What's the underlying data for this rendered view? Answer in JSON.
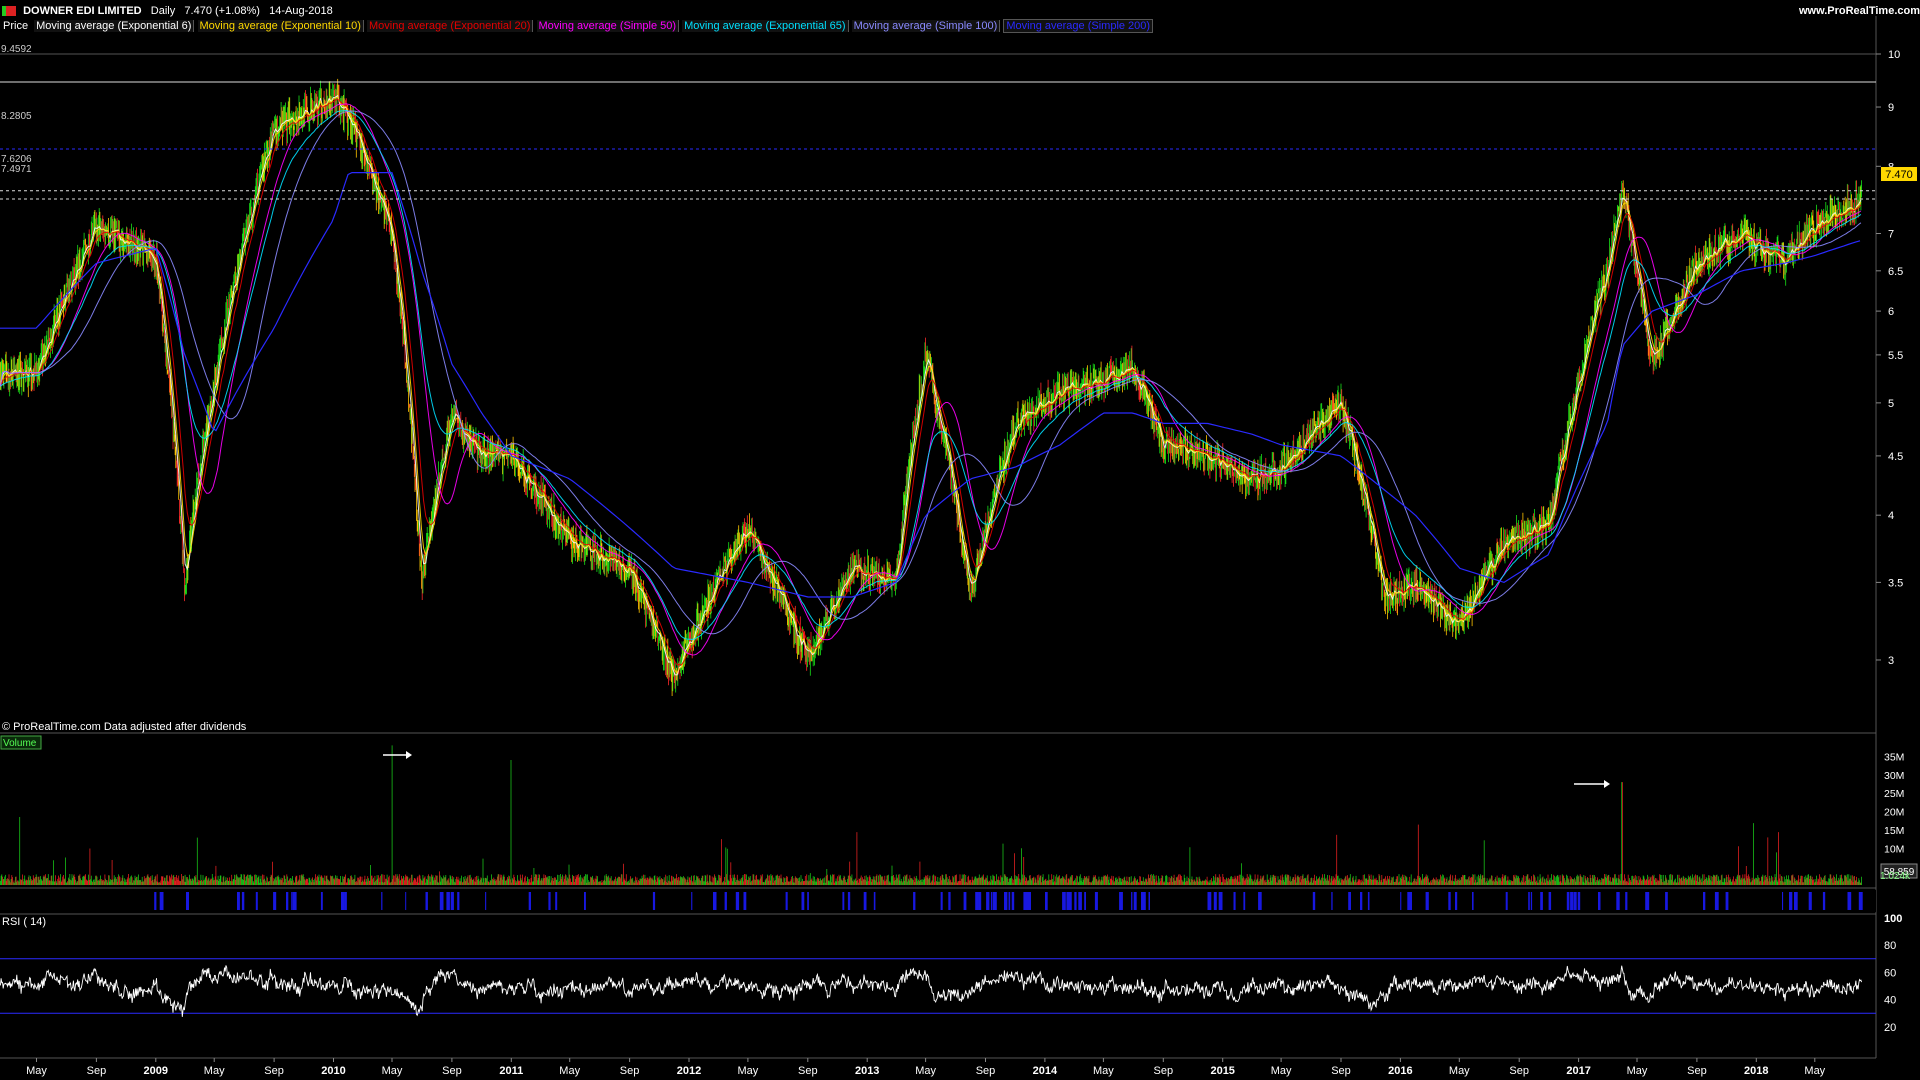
{
  "header": {
    "instrument": "DOWNER EDI LIMITED",
    "interval": "Daily",
    "last": "7.470 (+1.08%)",
    "date": "14-Aug-2018",
    "site": "www.ProRealTime.com"
  },
  "legend": {
    "price": "Price",
    "items": [
      {
        "label": "Moving average (Exponential 6)",
        "color": "#ffffff"
      },
      {
        "label": "Moving average (Exponential 10)",
        "color": "#ffd800"
      },
      {
        "label": "Moving average (Exponential 20)",
        "color": "#e60000"
      },
      {
        "label": "Moving average (Simple 50)",
        "color": "#ff00ff"
      },
      {
        "label": "Moving average (Exponential 65)",
        "color": "#00e0ff"
      },
      {
        "label": "Moving average (Simple 100)",
        "color": "#8a8aff"
      },
      {
        "label": "Moving average (Simple 200)",
        "color": "#2a2aff"
      }
    ]
  },
  "footnote": "© ProRealTime.com  Data adjusted after dividends",
  "price_levels": {
    "high": "9.4592",
    "mid": "8.2805",
    "a": "7.6206",
    "b": "7.4971",
    "current": "7.470"
  },
  "volume_panel": {
    "title": "Volume",
    "current": "1.024k"
  },
  "rsi_panel": {
    "title": "RSI ( 14)",
    "current": "58.859"
  },
  "chart_data": [
    {
      "type": "line",
      "title": "DOWNER EDI LIMITED Daily",
      "y_ticks": [
        3,
        3.5,
        4,
        4.5,
        5,
        5.5,
        6,
        6.5,
        7,
        8,
        9,
        10
      ],
      "ylim": [
        2.6,
        10
      ],
      "log_scale": true,
      "x_ticks": [
        "May",
        "Sep",
        "2009",
        "May",
        "Sep",
        "2010",
        "May",
        "Sep",
        "2011",
        "May",
        "Sep",
        "2012",
        "May",
        "Sep",
        "2013",
        "May",
        "Sep",
        "2014",
        "May",
        "Sep",
        "2015",
        "May",
        "Sep",
        "2016",
        "May",
        "Sep",
        "2017",
        "May",
        "Sep",
        "2018",
        "May"
      ],
      "x": [
        "2008-05",
        "2008-09",
        "2009-01",
        "2009-03",
        "2009-05",
        "2009-09",
        "2010-01",
        "2010-02",
        "2010-05",
        "2010-07",
        "2010-09",
        "2010-11",
        "2011-01",
        "2011-05",
        "2011-09",
        "2011-12",
        "2012-05",
        "2012-09",
        "2012-12",
        "2013-03",
        "2013-05",
        "2013-08",
        "2013-11",
        "2014-02",
        "2014-05",
        "2014-07",
        "2014-09",
        "2014-12",
        "2015-03",
        "2015-05",
        "2015-09",
        "2015-12",
        "2016-02",
        "2016-05",
        "2016-08",
        "2016-11",
        "2017-03",
        "2017-04",
        "2017-06",
        "2017-09",
        "2017-12",
        "2018-03",
        "2018-05",
        "2018-08"
      ],
      "series": [
        {
          "name": "Price",
          "values": [
            5.3,
            7.1,
            6.7,
            3.5,
            5.2,
            8.6,
            9.2,
            8.8,
            7.0,
            3.5,
            4.9,
            4.5,
            4.5,
            3.8,
            3.6,
            2.9,
            3.9,
            3.0,
            3.6,
            3.5,
            5.5,
            3.4,
            4.8,
            5.1,
            5.2,
            5.4,
            4.6,
            4.5,
            4.3,
            4.4,
            5.0,
            3.4,
            3.5,
            3.2,
            3.8,
            3.9,
            6.5,
            7.6,
            5.4,
            6.6,
            7.0,
            6.6,
            7.1,
            7.47
          ]
        },
        {
          "name": "Moving average (Simple 200)",
          "values": [
            5.8,
            6.6,
            6.8,
            5.5,
            4.7,
            5.8,
            7.2,
            7.9,
            7.9,
            6.5,
            5.4,
            4.9,
            4.5,
            4.3,
            3.9,
            3.6,
            3.5,
            3.4,
            3.4,
            3.5,
            4.0,
            4.3,
            4.4,
            4.6,
            4.9,
            4.9,
            4.8,
            4.8,
            4.7,
            4.6,
            4.5,
            4.2,
            4.0,
            3.6,
            3.5,
            3.7,
            4.8,
            5.6,
            6.0,
            6.2,
            6.5,
            6.6,
            6.7,
            6.9
          ]
        }
      ],
      "horizontal_lines": [
        9.4592,
        8.2805,
        7.6206,
        7.4971
      ]
    },
    {
      "type": "bar",
      "title": "Volume",
      "y_ticks": [
        "5.000k",
        "10M",
        "15M",
        "20M",
        "25M",
        "30M",
        "35M"
      ],
      "ylim": [
        0,
        40
      ],
      "notable_spikes_millions": [
        {
          "x": "2010-05",
          "value": 38
        },
        {
          "x": "2011-01",
          "value": 34
        },
        {
          "x": "2017-04",
          "value": 28
        }
      ],
      "typical_millions": 2
    },
    {
      "type": "line",
      "title": "RSI ( 14)",
      "y_ticks": [
        20,
        40,
        60,
        80,
        100
      ],
      "ylim": [
        0,
        100
      ],
      "bands": [
        30,
        70
      ],
      "current": 58.859
    }
  ]
}
